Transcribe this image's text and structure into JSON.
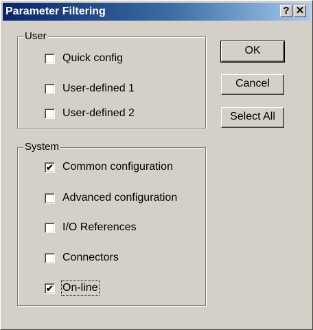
{
  "window": {
    "title": "Parameter Filtering",
    "help_glyph": "?",
    "close_glyph": "✕"
  },
  "groups": {
    "user": {
      "label": "User",
      "items": [
        {
          "label": "Quick config",
          "checked": false
        },
        {
          "label": "User-defined 1",
          "checked": false
        },
        {
          "label": "User-defined 2",
          "checked": false
        }
      ]
    },
    "system": {
      "label": "System",
      "items": [
        {
          "label": "Common configuration",
          "checked": true
        },
        {
          "label": "Advanced configuration",
          "checked": false
        },
        {
          "label": "I/O References",
          "checked": false
        },
        {
          "label": "Connectors",
          "checked": false
        },
        {
          "label": "On-line",
          "checked": true
        }
      ]
    }
  },
  "buttons": {
    "ok": "OK",
    "cancel": "Cancel",
    "select_all": "Select All"
  },
  "check_glyph": "✔"
}
